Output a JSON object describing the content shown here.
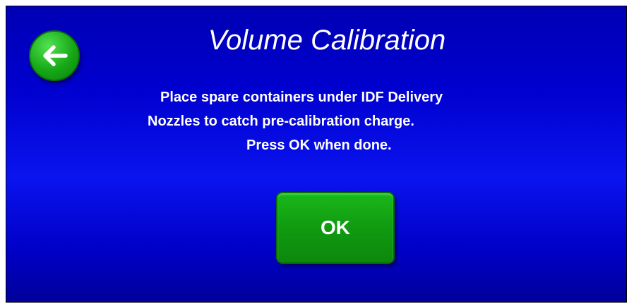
{
  "header": {
    "title": "Volume Calibration",
    "back_icon": "arrow-left-icon"
  },
  "message": {
    "lines": [
      "Place spare containers under IDF Delivery",
      "Nozzles to catch pre-calibration charge.",
      "Press OK when done."
    ]
  },
  "actions": {
    "ok_label": "OK"
  },
  "colors": {
    "background": "#0000cf",
    "button_green": "#109a10",
    "text": "#ffffff"
  }
}
